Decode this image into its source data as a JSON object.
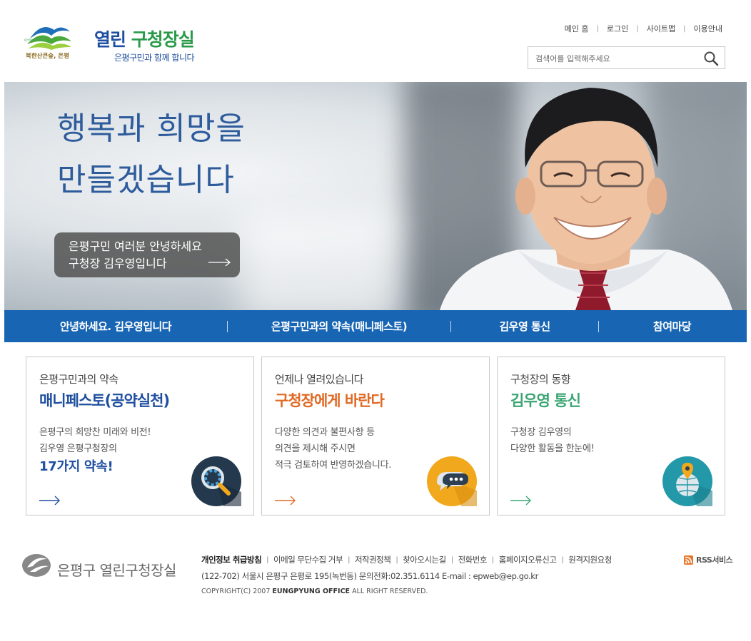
{
  "header": {
    "logo_tagline": "북한산큰숲, 은평",
    "logo_title_main": "열린",
    "logo_title_accent": " 구청장실",
    "logo_subtitle": "은평구민과 함께 합니다",
    "nav": [
      "메인 홈",
      "로그인",
      "사이트맵",
      "이용안내"
    ],
    "search": {
      "placeholder": "검색어를 입력해주세요",
      "icon": "search-icon"
    }
  },
  "hero": {
    "headline_line1": "행복과 희망을",
    "headline_line2": "만들겠습니다",
    "greeting_line1": "은평구민 여러분 안녕하세요",
    "greeting_line2": "구청장 김우영입니다"
  },
  "menu": [
    "안녕하세요. 김우영입니다",
    "은평구민과의 약속(매니페스토)",
    "김우영 통신",
    "참여마당"
  ],
  "cards": [
    {
      "kicker": "은평구민과의 약속",
      "title": "매니페스토(공약실천)",
      "title_color": "#1f4fa0",
      "desc": [
        "은평구의 희망찬 미래와 비전!",
        "김우영 은평구청장의"
      ],
      "emphasis": "17가지 약속!",
      "badge_color": "#24394e",
      "badge_icon": "magnifier-gear-icon",
      "arrow_color": "#1f4fa0"
    },
    {
      "kicker": "언제나 열려있습니다",
      "title": "구청장에게 바란다",
      "title_color": "#e06a25",
      "desc": [
        "다양한 의견과 불편사항 등",
        "의견을 제시해 주시면",
        "적극 검토하여 반영하겠습니다."
      ],
      "emphasis": "",
      "badge_color": "#f2a81d",
      "badge_icon": "chat-bubble-icon",
      "arrow_color": "#e06a25"
    },
    {
      "kicker": "구청장의 동향",
      "title": "김우영 통신",
      "title_color": "#3aa572",
      "desc": [
        "구청장 김우영의",
        "다양한 활동을 한눈에!"
      ],
      "emphasis": "",
      "badge_color": "#2398a8",
      "badge_icon": "globe-pin-icon",
      "arrow_color": "#3aa572"
    }
  ],
  "footer": {
    "logo_text": "은평구 열린구청장실",
    "links": [
      "개인정보 취급방침",
      "이메일 무단수집 거부",
      "저작권정책",
      "찾아오시는길",
      "전화번호",
      "홈페이지오류신고",
      "원격지원요청"
    ],
    "rss": "RSS서비스",
    "address": "(122-702) 서울시 은평구 은평로 195(녹번동) 문의전화:02.351.6114 E-mail : epweb@ep.go.kr",
    "copyright_pre": "COPYRIGHT(C) 2007 ",
    "copyright_org": "EUNGPYUNG OFFICE",
    "copyright_post": " ALL RIGHT RESERVED."
  }
}
